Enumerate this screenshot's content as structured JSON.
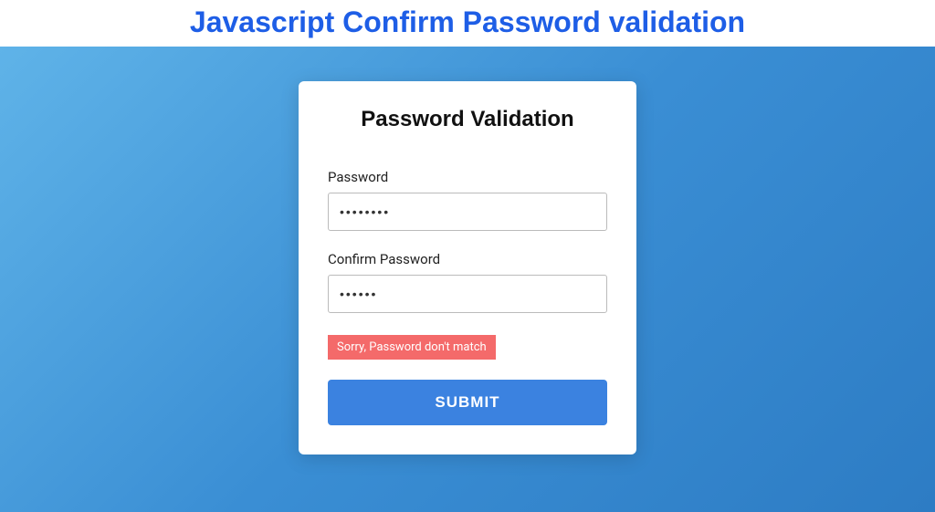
{
  "header": {
    "title": "Javascript Confirm Password validation"
  },
  "card": {
    "title": "Password Validation",
    "password_label": "Password",
    "password_value": "••••••••",
    "confirm_label": "Confirm Password",
    "confirm_value": "••••••",
    "error_message": "Sorry, Password don't match",
    "submit_label": "SUBMIT"
  }
}
